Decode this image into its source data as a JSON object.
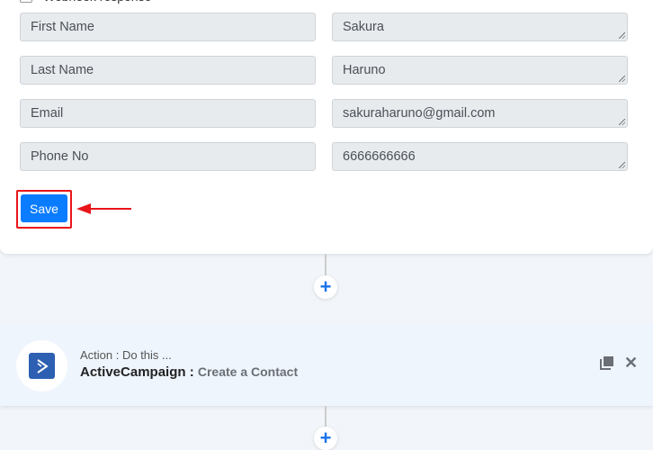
{
  "form": {
    "webhook_label": "Webhook response",
    "fields": [
      {
        "label": "First Name",
        "value": "Sakura"
      },
      {
        "label": "Last Name",
        "value": "Haruno"
      },
      {
        "label": "Email",
        "value": "sakuraharuno@gmail.com"
      },
      {
        "label": "Phone No",
        "value": "6666666666"
      }
    ],
    "save_label": "Save"
  },
  "action": {
    "subtitle": "Action : Do this ...",
    "app_name": "ActiveCampaign :",
    "event": "Create a Contact"
  },
  "colors": {
    "accent": "#0a7cff",
    "highlight": "#e8151b",
    "app_logo": "#2d5fb2"
  }
}
